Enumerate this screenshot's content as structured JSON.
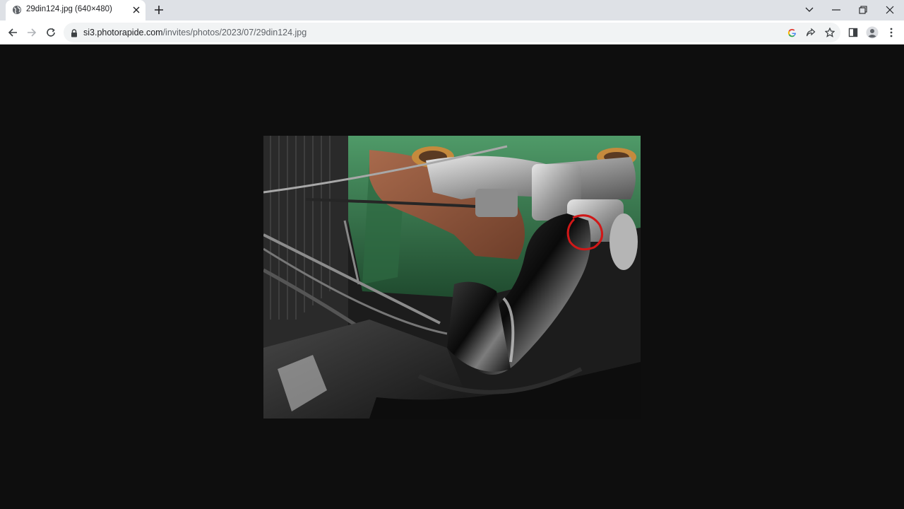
{
  "tab": {
    "title": "29din124.jpg (640×480)"
  },
  "address_bar": {
    "host": "si3.photorapide.com",
    "path": "/invites/photos/2023/07/29din124.jpg"
  },
  "icons": {
    "favicon": "globe-icon",
    "tab_close": "close-icon",
    "new_tab": "plus-icon",
    "tab_search": "chevron-down-icon",
    "minimize": "minimize-icon",
    "restore": "restore-icon",
    "close_window": "close-icon",
    "back": "arrow-left-icon",
    "forward": "arrow-right-icon",
    "reload": "reload-icon",
    "lock": "lock-icon",
    "google": "google-icon",
    "share": "share-icon",
    "bookmark": "star-icon",
    "side_panel": "side-panel-icon",
    "profile": "profile-icon",
    "menu": "kebab-menu-icon"
  },
  "colors": {
    "tabstrip_bg": "#dee1e6",
    "viewer_bg": "#0e0e0e",
    "engine_green": "#3f7d52",
    "annotation_red": "#d01818"
  },
  "image": {
    "alt": "engine bay photo with red circle annotation"
  }
}
